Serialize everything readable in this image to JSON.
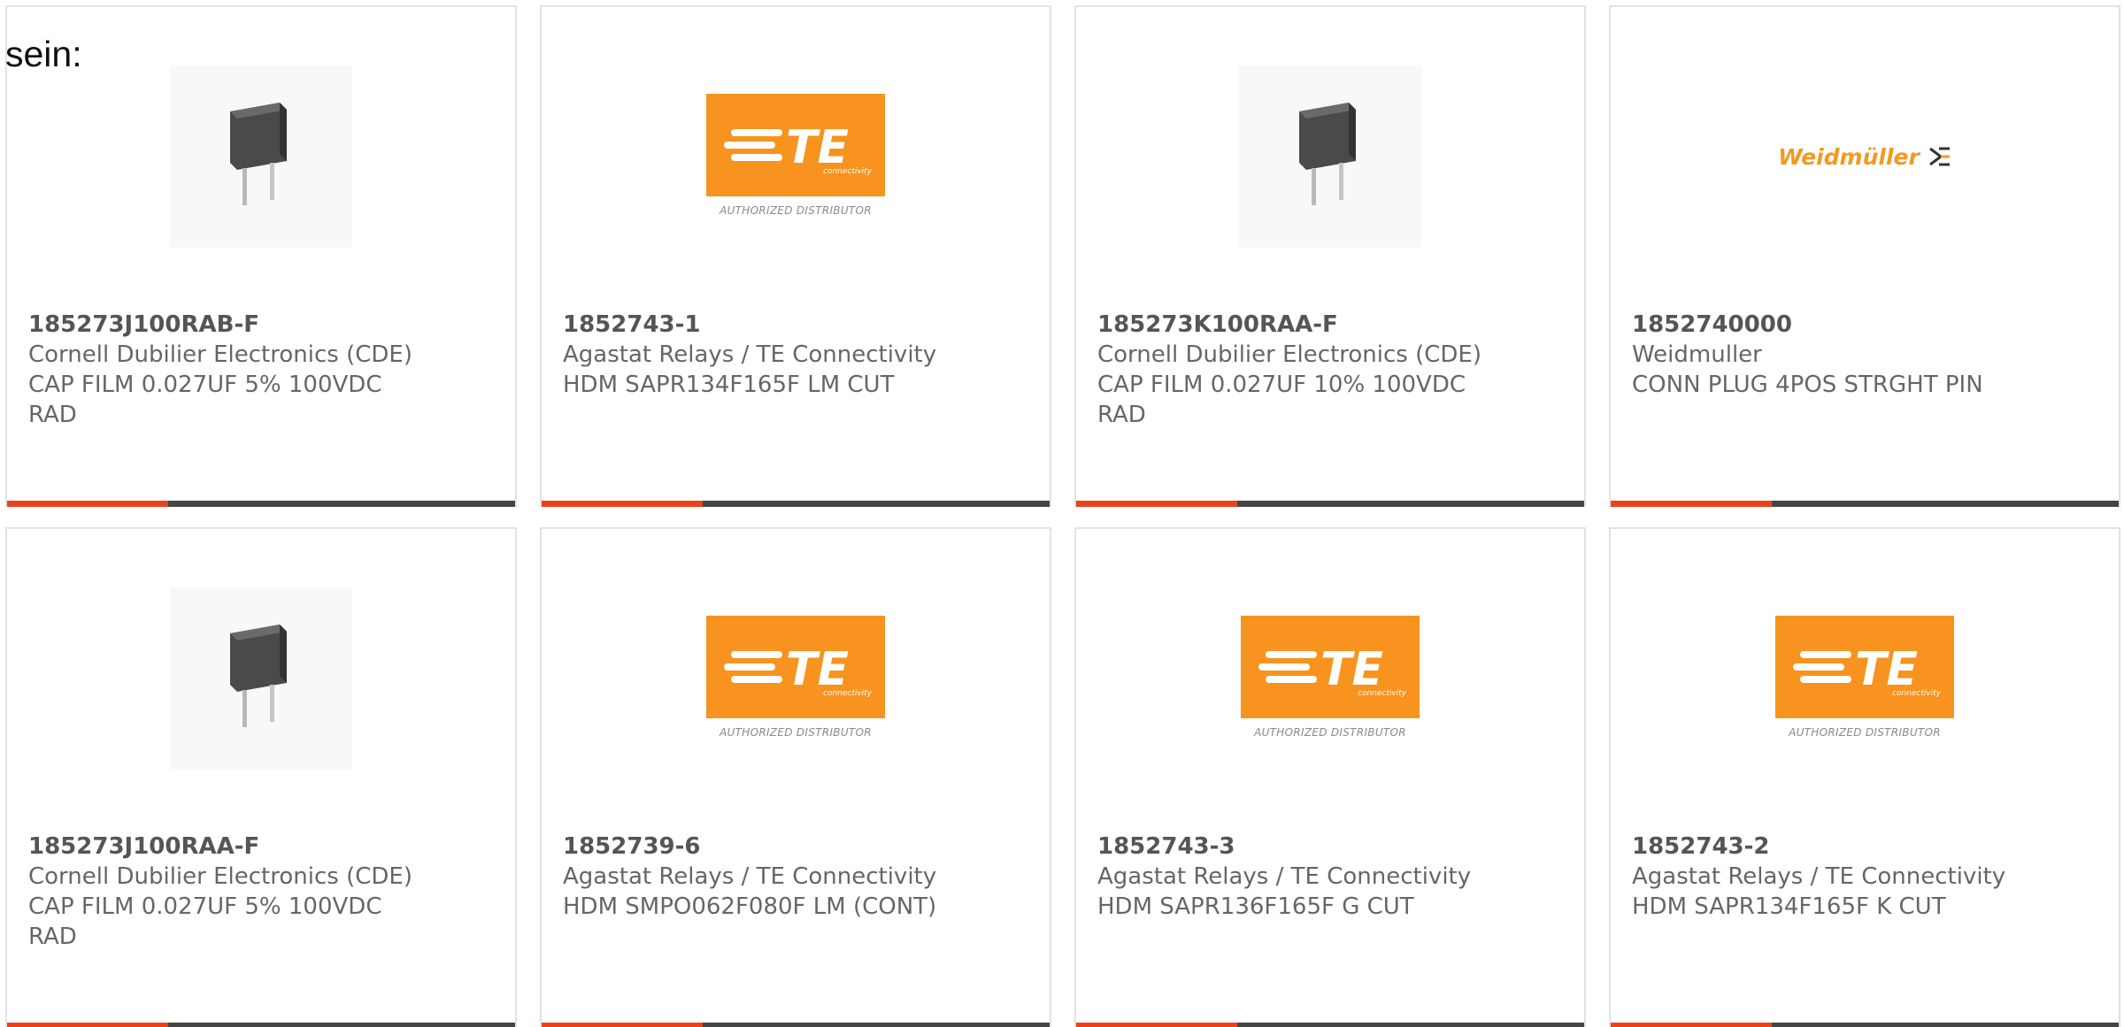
{
  "intro": {
    "text": "sein:"
  },
  "brand_colors": {
    "accent": "#e8431b",
    "bar": "#454545",
    "te_orange": "#f7931e",
    "weidmuller_orange": "#f29a22"
  },
  "products": [
    {
      "part_no": "185273J100RAB-F",
      "maker": "Cornell Dubilier Electronics (CDE)",
      "desc": "CAP FILM 0.027UF 5% 100VDC RAD",
      "image": "capacitor-photo"
    },
    {
      "part_no": "1852743-1",
      "maker": "Agastat Relays / TE Connectivity",
      "desc": "HDM SAPR134F165F LM CUT",
      "image": "te-logo",
      "logo_text": "TE",
      "logo_sub": "connectivity",
      "logo_caption": "AUTHORIZED DISTRIBUTOR"
    },
    {
      "part_no": "185273K100RAA-F",
      "maker": "Cornell Dubilier Electronics (CDE)",
      "desc": "CAP FILM 0.027UF 10% 100VDC RAD",
      "image": "capacitor-photo"
    },
    {
      "part_no": "1852740000",
      "maker": "Weidmuller",
      "desc": "CONN PLUG 4POS STRGHT PIN",
      "image": "weidmuller-logo",
      "logo_text": "Weidmüller"
    },
    {
      "part_no": "185273J100RAA-F",
      "maker": "Cornell Dubilier Electronics (CDE)",
      "desc": "CAP FILM 0.027UF 5% 100VDC RAD",
      "image": "capacitor-photo"
    },
    {
      "part_no": "1852739-6",
      "maker": "Agastat Relays / TE Connectivity",
      "desc": "HDM SMPO062F080F LM (CONT)",
      "image": "te-logo",
      "logo_text": "TE",
      "logo_sub": "connectivity",
      "logo_caption": "AUTHORIZED DISTRIBUTOR"
    },
    {
      "part_no": "1852743-3",
      "maker": "Agastat Relays / TE Connectivity",
      "desc": "HDM SAPR136F165F G CUT",
      "image": "te-logo",
      "logo_text": "TE",
      "logo_sub": "connectivity",
      "logo_caption": "AUTHORIZED DISTRIBUTOR"
    },
    {
      "part_no": "1852743-2",
      "maker": "Agastat Relays / TE Connectivity",
      "desc": "HDM SAPR134F165F K CUT",
      "image": "te-logo",
      "logo_text": "TE",
      "logo_sub": "connectivity",
      "logo_caption": "AUTHORIZED DISTRIBUTOR"
    }
  ]
}
